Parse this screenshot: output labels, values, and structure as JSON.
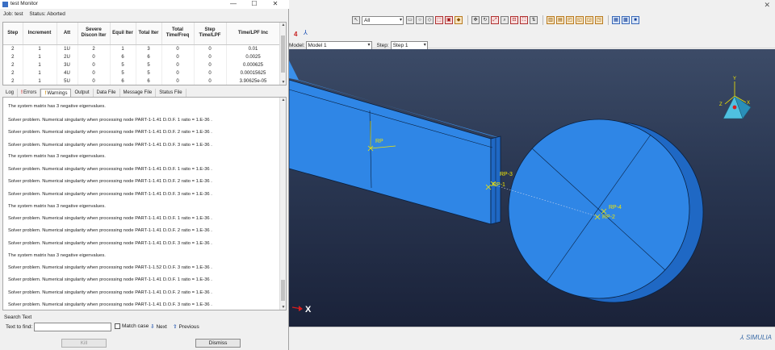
{
  "monitor": {
    "title": "test Monitor",
    "job_label": "Job: test",
    "status_label": "Status: Aborted",
    "columns": [
      "Step",
      "Increment",
      "Att",
      "Severe Discon Iter",
      "Equil Iter",
      "Total Iter",
      "Total Time/Freq",
      "Step Time/LPF",
      "Time/LPF Inc"
    ],
    "rows": [
      [
        "2",
        "1",
        "1U",
        "2",
        "1",
        "3",
        "0",
        "0",
        "0.01"
      ],
      [
        "2",
        "1",
        "2U",
        "0",
        "6",
        "6",
        "0",
        "0",
        "0.0025"
      ],
      [
        "2",
        "1",
        "3U",
        "0",
        "5",
        "5",
        "0",
        "0",
        "0.000625"
      ],
      [
        "2",
        "1",
        "4U",
        "0",
        "5",
        "5",
        "0",
        "0",
        "0.00015625"
      ],
      [
        "2",
        "1",
        "5U",
        "0",
        "6",
        "6",
        "0",
        "0",
        "3.90625e-05"
      ]
    ],
    "tabs": {
      "log": "Log",
      "errors": "Errors",
      "warnings": "Warnings",
      "output": "Output",
      "data_file": "Data File",
      "message_file": "Message File",
      "status_file": "Status File"
    },
    "messages": [
      "The system matrix has 3 negative eigenvalues.",
      "Solver problem. Numerical singularity when processing node PART-1-1.41 D.O.F. 1 ratio = 1.E-36   .",
      "Solver problem. Numerical singularity when processing node PART-1-1.41 D.O.F. 2 ratio = 1.E-36   .",
      "Solver problem. Numerical singularity when processing node PART-1-1.41 D.O.F. 3 ratio = 1.E-36   .",
      "The system matrix has 3 negative eigenvalues.",
      "Solver problem. Numerical singularity when processing node PART-1-1.41 D.O.F. 1 ratio = 1.E-36   .",
      "Solver problem. Numerical singularity when processing node PART-1-1.41 D.O.F. 2 ratio = 1.E-36   .",
      "Solver problem. Numerical singularity when processing node PART-1-1.41 D.O.F. 3 ratio = 1.E-36   .",
      "The system matrix has 3 negative eigenvalues.",
      "Solver problem. Numerical singularity when processing node PART-1-1.41 D.O.F. 1 ratio = 1.E-36   .",
      "Solver problem. Numerical singularity when processing node PART-1-1.41 D.O.F. 2 ratio = 1.E-36   .",
      "Solver problem. Numerical singularity when processing node PART-1-1.41 D.O.F. 3 ratio = 1.E-36   .",
      "The system matrix has 3 negative eigenvalues.",
      "Solver problem. Numerical singularity when processing node PART-1-1.52 D.O.F. 3 ratio = 1.E-36   .",
      "Solver problem. Numerical singularity when processing node PART-1-1.41 D.O.F. 1 ratio = 1.E-36   .",
      "Solver problem. Numerical singularity when processing node PART-1-1.41 D.O.F. 2 ratio = 1.E-36   .",
      "Solver problem. Numerical singularity when processing node PART-1-1.41 D.O.F. 3 ratio = 1.E-36   ."
    ],
    "search_text_label": "Search Text",
    "text_to_find_label": "Text to find:",
    "find_value": "",
    "match_case_label": "Match case",
    "next_label": "Next",
    "previous_label": "Previous",
    "kill_label": "Kill",
    "dismiss_label": "Dismiss"
  },
  "viewer": {
    "selection_filter": "All",
    "step_count_badge": "4",
    "model_label": "Model:",
    "model_value": "Model 1",
    "step_label": "Step:",
    "step_value": "Step 1",
    "rp_labels": [
      "RP-3",
      "RP-1",
      "RP-4",
      "RP-2",
      "RP"
    ],
    "axis_x": "X",
    "axis_y": "Y",
    "axis_z": "Z",
    "triad_x": "X",
    "brand": "SIMULIA",
    "colors": {
      "part_face": "#2f86e6",
      "part_side": "#1f68c4",
      "part_edge": "#0a1f3d",
      "rp_marker": "#f2e600",
      "background_top": "#3c4b67",
      "background_bottom": "#1a2239"
    }
  }
}
